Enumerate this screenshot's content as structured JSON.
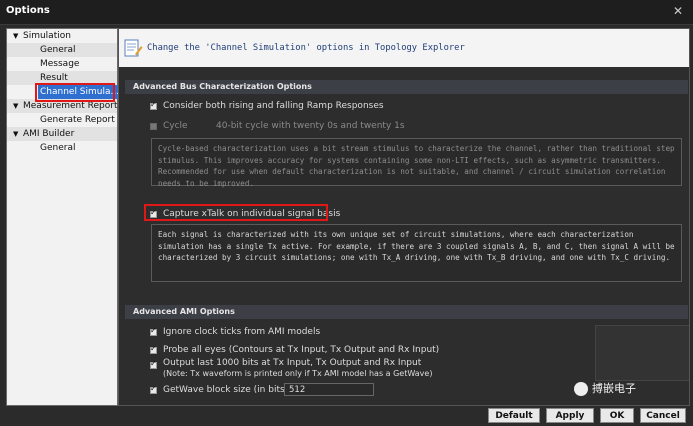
{
  "window": {
    "title": "Options",
    "close_glyph": "✕"
  },
  "tree": {
    "items": [
      {
        "label": "Simulation",
        "level": 0,
        "expanded": true
      },
      {
        "label": "General",
        "level": 1
      },
      {
        "label": "Message",
        "level": 1
      },
      {
        "label": "Result",
        "level": 1
      },
      {
        "label": "Channel Simula...",
        "level": 1,
        "selected": true
      },
      {
        "label": "Measurement Report",
        "level": 0,
        "expanded": true
      },
      {
        "label": "Generate Report",
        "level": 1
      },
      {
        "label": "AMI Builder",
        "level": 0,
        "expanded": true
      },
      {
        "label": "General",
        "level": 1
      }
    ]
  },
  "banner": {
    "text": "Change the 'Channel Simulation' options in Topology Explorer",
    "icon": "document-edit-icon"
  },
  "sections": {
    "bus": {
      "header": "Advanced Bus Characterization Options",
      "ramp_label": "Consider both rising and falling Ramp Responses",
      "cycle_label": "Cycle",
      "cycle_value": "40-bit cycle with twenty 0s and twenty 1s",
      "cycle_desc": "Cycle-based characterization uses a bit stream stimulus to characterize the channel, rather than traditional step stimulus. This improves accuracy for systems containing some non-LTI effects, such as asymmetric transmitters. Recommended for use when default characterization is not suitable, and channel / circuit simulation correlation needs to be improved.",
      "xtalk_label": "Capture xTalk on individual signal basis",
      "xtalk_desc": "Each signal is characterized with its own unique set of circuit simulations, where each characterization simulation has a single Tx active. For example, if there are 3 coupled signals A, B, and C, then signal A will be characterized by 3 circuit simulations; one with Tx_A driving, one with Tx_B driving, and one with Tx_C driving."
    },
    "ami": {
      "header": "Advanced AMI Options",
      "ignore_clock_label": "Ignore clock ticks from AMI models",
      "probe_label": "Probe all eyes (Contours at Tx Input, Tx Output and Rx Input)",
      "output_label": "Output last 1000 bits at Tx  Input, Tx Output and Rx Input",
      "output_note": "(Note: Tx waveform is printed only if Tx AMI model has a GetWave)",
      "getwave_label": "GetWave block size  (in bits)",
      "getwave_value": "512"
    }
  },
  "buttons": {
    "default": "Default",
    "apply": "Apply",
    "ok": "OK",
    "cancel": "Cancel"
  },
  "watermark": {
    "text": "搏嵌电子"
  },
  "colors": {
    "highlight": "#e01818",
    "selection": "#2f6fcf"
  }
}
